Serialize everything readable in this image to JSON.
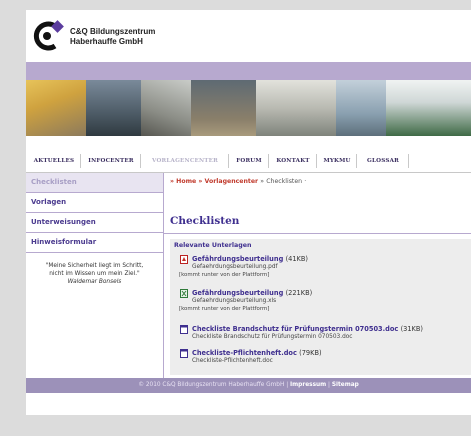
{
  "header": {
    "company_line1": "C&Q Bildungszentrum",
    "company_line2": "Haberhauffe GmbH"
  },
  "nav": {
    "tabs": [
      {
        "label": "AKTUELLES"
      },
      {
        "label": "INFOCENTER"
      },
      {
        "label": "VORLAGENCENTER",
        "active": true
      },
      {
        "label": "FORUM"
      },
      {
        "label": "KONTAKT"
      },
      {
        "label": "MYKMU"
      },
      {
        "label": "GLOSSAR"
      }
    ]
  },
  "sidebar": {
    "items": [
      {
        "label": "Checklisten",
        "active": true
      },
      {
        "label": "Vorlagen"
      },
      {
        "label": "Unterweisungen"
      },
      {
        "label": "Hinweisformular"
      }
    ],
    "quote_line1": "\"Meine Sicherheit liegt im Schritt,",
    "quote_line2": "nicht im Wissen um mein Ziel.\"",
    "quote_author": "Waldemar Bonsels"
  },
  "breadcrumb": {
    "home": "» Home",
    "sep1": "»",
    "section": "Vorlagencenter",
    "sep2": "»",
    "current": "Checklisten",
    "tail": "·"
  },
  "main": {
    "title": "Checklisten",
    "section_title": "Relevante Unterlagen",
    "documents": [
      {
        "title": "Gefährdungsbeurteilung",
        "size": "(41KB)",
        "file": "Gefaehrdungsbeurteilung.pdf",
        "note": "[kommt runter von der Plattform]",
        "icon": "pdf-icon"
      },
      {
        "title": "Gefährdungsbeurteilung",
        "size": "(221KB)",
        "file": "Gefaehrdungsbeurteilung.xls",
        "note": "[kommt runter von der Plattform]",
        "icon": "xls-icon"
      },
      {
        "title": "Checkliste Brandschutz für Prüfungstermin 070503.doc",
        "size": "(31KB)",
        "file": "Checkliste Brandschutz für Prüfungstermin 070503.doc",
        "note": "",
        "icon": "doc-icon"
      },
      {
        "title": "Checkliste-Pflichtenheft.doc",
        "size": "(79KB)",
        "file": "Checkliste-Pflichtenheft.doc",
        "note": "",
        "icon": "doc-icon"
      }
    ]
  },
  "footer": {
    "copyright": "© 2010 C&Q Bildungszentrum Haberhauffe GmbH",
    "sep": "|",
    "impressum": "Impressum",
    "sep2": "|",
    "sitemap": "Sitemap"
  },
  "colors": {
    "accent": "#3f2f8f",
    "bar": "#b7a9cf",
    "footer": "#9c91b9",
    "breadcrumb": "#c0392b"
  }
}
